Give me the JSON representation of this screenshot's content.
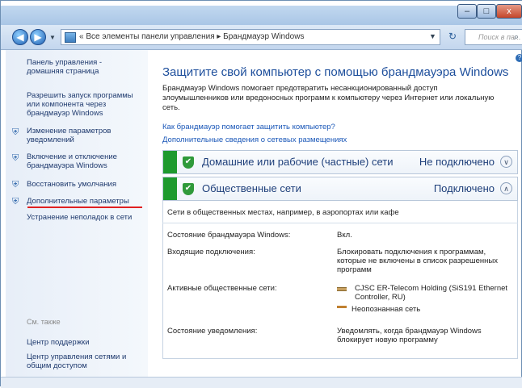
{
  "window": {
    "minimize": "–",
    "maximize": "□",
    "close": "x"
  },
  "nav": {
    "back_icon": "◀",
    "forward_icon": "▶",
    "address": "« Все элементы панели управления ▸ Брандмауэр Windows",
    "refresh_icon": "↻",
    "search_placeholder": "Поиск в па...",
    "search_icon": "⌕"
  },
  "sidebar": {
    "home": "Панель управления - домашняя страница",
    "allow_program": "Разрешить запуск программы или компонента через брандмауэр Windows",
    "change_notifications": "Изменение параметров уведомлений",
    "turn_on_off": "Включение и отключение брандмауэра Windows",
    "restore_defaults": "Восстановить умолчания",
    "advanced": "Дополнительные параметры",
    "troubleshoot": "Устранение неполадок в сети",
    "see_also": "См. также",
    "action_center": "Центр поддержки",
    "network_center": "Центр управления сетями и общим доступом",
    "shield_icon": "⛨"
  },
  "main": {
    "help_icon": "?",
    "title": "Защитите свой компьютер с помощью брандмауэра Windows",
    "intro": "Брандмауэр Windows помогает предотвратить несанкционированный доступ злоумышленников или вредоносных программ к компьютеру через Интернет или локальную сеть.",
    "link_how": "Как брандмауэр помогает защитить компьютер?",
    "link_locations": "Дополнительные сведения о сетевых размещениях",
    "home_network": {
      "name": "Домашние или рабочие (частные) сети",
      "status": "Не подключено",
      "chevron": "∨"
    },
    "public_network": {
      "name": "Общественные сети",
      "status": "Подключено",
      "chevron": "∧"
    },
    "check": "✔",
    "public_desc": "Сети в общественных местах, например, в аэропортах или кафе",
    "details": {
      "state_label": "Состояние брандмауэра Windows:",
      "state_value": "Вкл.",
      "incoming_label": "Входящие подключения:",
      "incoming_value": "Блокировать подключения к программам, которые не включены в список разрешенных программ",
      "active_label": "Активные общественные сети:",
      "active_eth": "CJSC ER-Telecom Holding (SiS191 Ethernet Controller, RU)",
      "active_unknown": "Неопознанная сеть",
      "notify_label": "Состояние уведомления:",
      "notify_value": "Уведомлять, когда брандмауэр Windows блокирует новую программу"
    }
  }
}
